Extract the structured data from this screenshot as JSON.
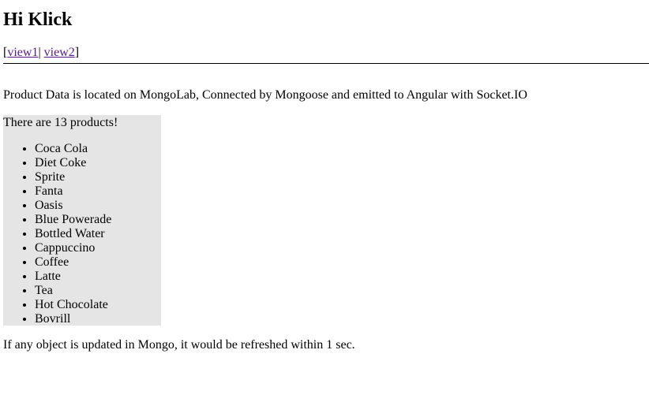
{
  "header": {
    "title": "Hi Klick"
  },
  "nav": {
    "open_bracket": "[",
    "view1_label": "view1",
    "separator": "|",
    "view2_label": "view2",
    "close_bracket": "]"
  },
  "main": {
    "description": "Product Data is located on MongoLab, Connected by Mongoose and emitted to Angular with Socket.IO",
    "count_text": "There are 13 products!",
    "products": [
      "Coca Cola",
      "Diet Coke",
      "Sprite",
      "Fanta",
      "Oasis",
      "Blue Powerade",
      "Bottled Water",
      "Cappuccino",
      "Coffee",
      "Latte",
      "Tea",
      "Hot Chocolate",
      "Bovrill"
    ],
    "footer_note": "If any object is updated in Mongo, it would be refreshed within 1 sec."
  },
  "colors": {
    "product_box_bg": "#e5e5e5",
    "link": "#551a8b"
  }
}
